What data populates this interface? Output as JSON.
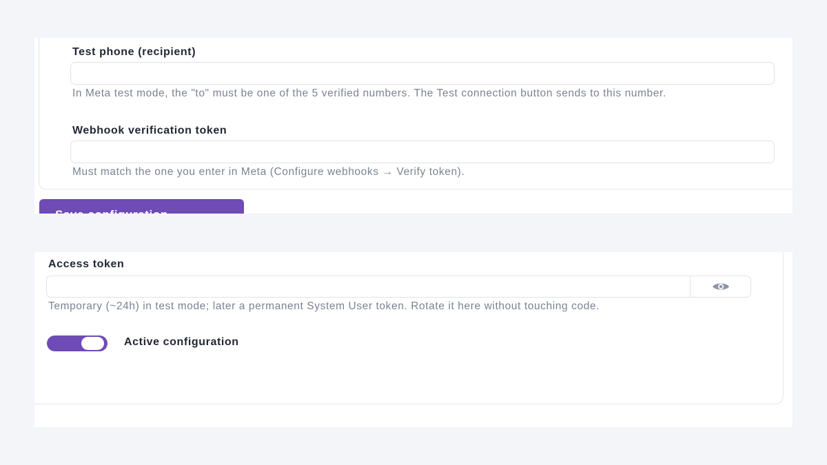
{
  "form_top": {
    "test_phone": {
      "label": "Test phone (recipient)",
      "value": "",
      "help": "In Meta test mode, the \"to\" must be one of the 5 verified numbers. The Test connection button sends to this number."
    },
    "webhook_token": {
      "label": "Webhook verification token",
      "value": "",
      "help": "Must match the one you enter in Meta (Configure webhooks → Verify token)."
    },
    "save_button_label": "Save configuration"
  },
  "form_bottom": {
    "access_token": {
      "label": "Access token",
      "value": "",
      "help": "Temporary (~24h) in test mode; later a permanent System User token. Rotate it here without touching code.",
      "reveal_icon": "eye-icon"
    },
    "active_toggle": {
      "label": "Active configuration",
      "checked": true
    }
  },
  "colors": {
    "accent": "#6f4bb5",
    "page_background": "#f4f5f9",
    "help_text": "#7b8391",
    "border": "#dfe2e8"
  }
}
